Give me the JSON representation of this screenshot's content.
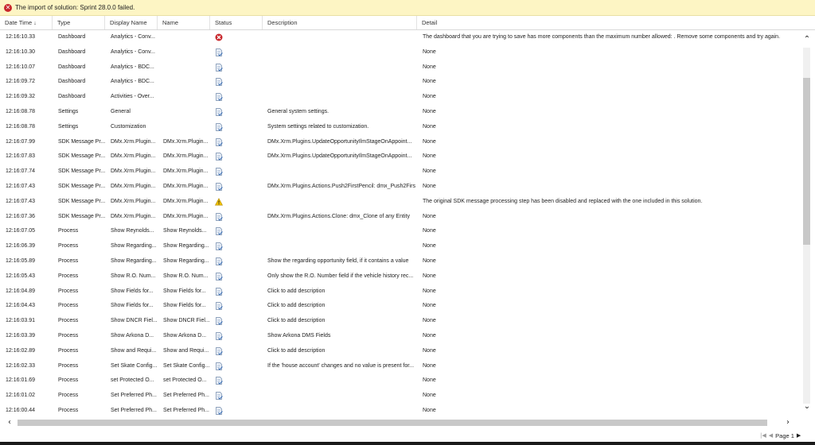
{
  "banner": {
    "icon": "error-icon",
    "message": "The import of solution: Sprint 28.0.0 failed."
  },
  "columns": [
    {
      "key": "date",
      "label": "Date Time",
      "sort": "↓"
    },
    {
      "key": "type",
      "label": "Type"
    },
    {
      "key": "display",
      "label": "Display Name"
    },
    {
      "key": "name",
      "label": "Name"
    },
    {
      "key": "status",
      "label": "Status"
    },
    {
      "key": "desc",
      "label": "Description"
    },
    {
      "key": "detail",
      "label": "Detail"
    }
  ],
  "rows": [
    {
      "date": "12:16:10.33",
      "type": "Dashboard",
      "display": "Analytics - Conv...",
      "name": "",
      "status": "error",
      "desc": "",
      "detail": "The dashboard that you are trying to save has more components than the maximum number allowed: . Remove some components and try again."
    },
    {
      "date": "12:16:10.30",
      "type": "Dashboard",
      "display": "Analytics - Conv...",
      "name": "",
      "status": "success",
      "desc": "",
      "detail": "None"
    },
    {
      "date": "12:16:10.07",
      "type": "Dashboard",
      "display": "Analytics - BDC...",
      "name": "",
      "status": "success",
      "desc": "",
      "detail": "None"
    },
    {
      "date": "12:16:09.72",
      "type": "Dashboard",
      "display": "Analytics - BDC...",
      "name": "",
      "status": "success",
      "desc": "",
      "detail": "None"
    },
    {
      "date": "12:16:09.32",
      "type": "Dashboard",
      "display": "Activities - Over...",
      "name": "",
      "status": "success",
      "desc": "",
      "detail": "None"
    },
    {
      "date": "12:16:08.78",
      "type": "Settings",
      "display": "General",
      "name": "",
      "status": "success",
      "desc": "General system settings.",
      "detail": "None"
    },
    {
      "date": "12:16:08.78",
      "type": "Settings",
      "display": "Customization",
      "name": "",
      "status": "success",
      "desc": "System settings related to customization.",
      "detail": "None"
    },
    {
      "date": "12:16:07.99",
      "type": "SDK Message Pr...",
      "display": "DMx.Xrm.Plugin...",
      "name": "DMx.Xrm.Plugin...",
      "status": "success",
      "desc": "DMx.Xrm.Plugins.UpdateOpportunityIlmStageOnAppoint...",
      "detail": "None"
    },
    {
      "date": "12:16:07.83",
      "type": "SDK Message Pr...",
      "display": "DMx.Xrm.Plugin...",
      "name": "DMx.Xrm.Plugin...",
      "status": "success",
      "desc": "DMx.Xrm.Plugins.UpdateOpportunityIlmStageOnAppoint...",
      "detail": "None"
    },
    {
      "date": "12:16:07.74",
      "type": "SDK Message Pr...",
      "display": "DMx.Xrm.Plugin...",
      "name": "DMx.Xrm.Plugin...",
      "status": "success",
      "desc": "",
      "detail": "None"
    },
    {
      "date": "12:16:07.43",
      "type": "SDK Message Pr...",
      "display": "DMx.Xrm.Plugin...",
      "name": "DMx.Xrm.Plugin...",
      "status": "success",
      "desc": "DMx.Xrm.Plugins.Actions.Push2FirstPencil: dmx_Push2Firs...",
      "detail": "None"
    },
    {
      "date": "12:16:07.43",
      "type": "SDK Message Pr...",
      "display": "DMx.Xrm.Plugin...",
      "name": "DMx.Xrm.Plugin...",
      "status": "warning",
      "desc": "",
      "detail": "The original SDK message processing step has been disabled and replaced with the one included in this solution."
    },
    {
      "date": "12:16:07.36",
      "type": "SDK Message Pr...",
      "display": "DMx.Xrm.Plugin...",
      "name": "DMx.Xrm.Plugin...",
      "status": "success",
      "desc": "DMx.Xrm.Plugins.Actions.Clone: dmx_Clone of any Entity",
      "detail": "None"
    },
    {
      "date": "12:16:07.05",
      "type": "Process",
      "display": "Show Reynolds...",
      "name": "Show Reynolds...",
      "status": "success",
      "desc": "",
      "detail": "None"
    },
    {
      "date": "12:16:06.39",
      "type": "Process",
      "display": "Show Regarding...",
      "name": "Show Regarding...",
      "status": "success",
      "desc": "",
      "detail": "None"
    },
    {
      "date": "12:16:05.89",
      "type": "Process",
      "display": "Show Regarding...",
      "name": "Show Regarding...",
      "status": "success",
      "desc": "Show the regarding opportunity field, if it contains a value",
      "detail": "None"
    },
    {
      "date": "12:16:05.43",
      "type": "Process",
      "display": "Show R.O. Num...",
      "name": "Show R.O. Num...",
      "status": "success",
      "desc": "Only show the R.O. Number field if the vehicle history rec...",
      "detail": "None"
    },
    {
      "date": "12:16:04.89",
      "type": "Process",
      "display": "Show Fields for...",
      "name": "Show Fields for...",
      "status": "success",
      "desc": "Click to add description",
      "detail": "None"
    },
    {
      "date": "12:16:04.43",
      "type": "Process",
      "display": "Show Fields for...",
      "name": "Show Fields for...",
      "status": "success",
      "desc": "Click to add description",
      "detail": "None"
    },
    {
      "date": "12:16:03.91",
      "type": "Process",
      "display": "Show DNCR Fiel...",
      "name": "Show DNCR Fiel...",
      "status": "success",
      "desc": "Click to add description",
      "detail": "None"
    },
    {
      "date": "12:16:03.39",
      "type": "Process",
      "display": "Show Arkona D...",
      "name": "Show Arkona D...",
      "status": "success",
      "desc": "Show Arkona DMS Fields",
      "detail": "None"
    },
    {
      "date": "12:16:02.89",
      "type": "Process",
      "display": "Show and Requi...",
      "name": "Show and Requi...",
      "status": "success",
      "desc": "Click to add description",
      "detail": "None"
    },
    {
      "date": "12:16:02.33",
      "type": "Process",
      "display": "Set Skate Config...",
      "name": "Set Skate Config...",
      "status": "success",
      "desc": "If the 'house account' changes and no value is present for...",
      "detail": "None"
    },
    {
      "date": "12:16:01.69",
      "type": "Process",
      "display": "set Protected O...",
      "name": "set Protected O...",
      "status": "success",
      "desc": "",
      "detail": "None"
    },
    {
      "date": "12:16:01.02",
      "type": "Process",
      "display": "Set Preferred Ph...",
      "name": "Set Preferred Ph...",
      "status": "success",
      "desc": "",
      "detail": "None"
    },
    {
      "date": "12:16:00.44",
      "type": "Process",
      "display": "Set Preferred Ph...",
      "name": "Set Preferred Ph...",
      "status": "success",
      "desc": "",
      "detail": "None"
    }
  ],
  "pager": {
    "label": "Page 1"
  },
  "colors": {
    "banner_bg": "#fdf5c4",
    "error": "#c8262b",
    "warning": "#f2c200"
  }
}
